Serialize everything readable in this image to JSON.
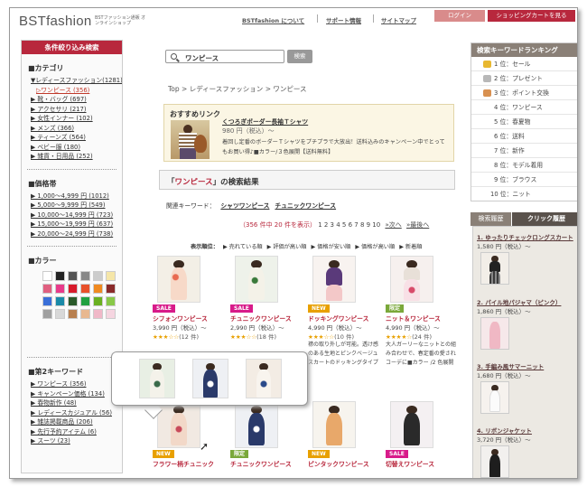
{
  "header": {
    "logo": "BSTfashion",
    "tagline": "BSTファッション通販 オンラインショップ",
    "nav": [
      "BSTfashion について",
      "サポート情報",
      "サイトマップ"
    ],
    "login": "ログイン",
    "cart": "ショッピングカートを見る"
  },
  "sidebar": {
    "title": "条件絞り込み検索",
    "category_head": "■カテゴリ",
    "categories": [
      "▼レディースファッション(1281)",
      "▷ワンピース (356)",
      "▶ 靴・バッグ (697)",
      "▶ アクセサリ (217)",
      "▶ 女性インナー (102)",
      "▶ メンズ (366)",
      "▶ ティーンズ (564)",
      "▶ ベビー服 (180)",
      "▶ 雑貨・日用品 (252)"
    ],
    "price_head": "■価格帯",
    "prices": [
      "▶ 1,000〜4,999 円 (1012)",
      "▶ 5,000〜9,999 円 (549)",
      "▶ 10,000〜14,999 円 (723)",
      "▶ 15,000〜19,999 円 (637)",
      "▶ 20,000〜24,999 円 (738)"
    ],
    "color_head": "■カラー",
    "colors": [
      "#ffffff",
      "#222222",
      "#555555",
      "#888888",
      "#cccccc",
      "#f5e6a8",
      "#e06080",
      "#e83a8a",
      "#d81b2b",
      "#e8502a",
      "#f08a20",
      "#8a2a2a",
      "#3a6fd8",
      "#1a8aa8",
      "#2a5a2a",
      "#20a040",
      "#6ab020",
      "#88c848",
      "#a0a0a0",
      "#d8d8d8",
      "#b88050",
      "#e8b890",
      "#f0b8c8",
      "#f5d5e0"
    ],
    "kw_head": "■第2キーワード",
    "keywords": [
      "▶ ワンピース (356)",
      "▶ キャンペーン価格 (134)",
      "▶ 春物新作 (48)",
      "▶ レディースカジュアル (56)",
      "▶ 雑誌掲載商品 (206)",
      "▶ 先行予約アイテム (6)",
      "▶ スーツ (23)"
    ]
  },
  "search": {
    "value": "ワンピース",
    "button": "検索"
  },
  "breadcrumb": "Top > レディースファッション > ワンピース",
  "recommend": {
    "title": "おすすめリンク",
    "name": "くつろぎボーダー長袖Ｔシャツ",
    "price": "980 円（税込）〜",
    "desc": "着回し定番のボーダーＴシャツをプチプラで大放出！送料込みのキャンペーン中でとってもお買い得♪■カラー/３色展開【送料無料】"
  },
  "result": {
    "title_pre": "「",
    "query": "ワンピース",
    "title_post": "」の検索結果",
    "kw_label": "関連キーワード：",
    "kws": [
      "シャツワンピース",
      "チュニックワンピース"
    ],
    "count": "（356 件中 20 件を表示）",
    "pages": "1 2 3 4 5 6 7 8 9 10",
    "next": "»次へ",
    "last": "»最後へ"
  },
  "sort": {
    "label": "表示順位：",
    "options": [
      "▶ 売れている順",
      "▶ 評価が高い順",
      "▶ 価格が安い順",
      "▶ 価格が高い順",
      "▶ 新着順"
    ]
  },
  "products": [
    {
      "badge": "SALE",
      "badge_color": "#d81b8a",
      "name": "シフォンワンピース",
      "price": "3,990 円（税込）〜",
      "stars": "★★★☆☆",
      "count": "(12 件)"
    },
    {
      "badge": "SALE",
      "badge_color": "#d81b8a",
      "name": "チュニックワンピース",
      "price": "2,990 円（税込）〜",
      "stars": "★★★☆☆",
      "count": "(18 件)"
    },
    {
      "badge": "NEW",
      "badge_color": "#e8a000",
      "name": "ドッキングワンピース",
      "price": "4,990 円（税込）〜",
      "stars": "★★★☆☆",
      "count": "(10 件)",
      "desc": "襟の取り外しが可能。透け感のある生地とピンクベージュスカートのドッキングタイプ"
    },
    {
      "badge": "限定",
      "badge_color": "#7aa83a",
      "name": "ニット＆ワンピース",
      "price": "4,990 円（税込）〜",
      "stars": "★★★★☆",
      "count": "(24 件)",
      "desc": "大人ガーリーなニットとの組み合わせで、春定番の愛されコーデに■カラー /2 色展開"
    },
    {
      "badge": "NEW",
      "badge_color": "#e8a000",
      "name": "フラワー柄チュニック",
      "price": ""
    },
    {
      "badge": "限定",
      "badge_color": "#7aa83a",
      "name": "チュニックワンピース",
      "price": ""
    },
    {
      "badge": "NEW",
      "badge_color": "#e8a000",
      "name": "ピンタックワンピース",
      "price": ""
    },
    {
      "badge": "SALE",
      "badge_color": "#d81b8a",
      "name": "切替えワンピース",
      "price": ""
    }
  ],
  "ranking": {
    "title": "検索キーワードランキング",
    "rows": [
      "1 位：セール",
      "2 位：プレゼント",
      "3 位：ポイント交換",
      "4 位：ワンピース",
      "5 位：春夏物",
      "6 位：送料",
      "7 位：新作",
      "8 位：モデル着用",
      "9 位：ブラウス",
      "10 位：ニット"
    ]
  },
  "history": {
    "tab1": "検索履歴",
    "tab2": "クリック履歴",
    "items": [
      {
        "name": "1. ゆったりチェックロングスカート",
        "price": "1,580 円（税込）〜"
      },
      {
        "name": "2. パイル地パジャマ（ピンク）",
        "price": "1,860 円（税込）〜"
      },
      {
        "name": "3. 手編み風サマーニット",
        "price": "1,680 円（税込）〜"
      },
      {
        "name": "4. リボンジャケット",
        "price": "3,720 円（税込）〜"
      }
    ]
  }
}
